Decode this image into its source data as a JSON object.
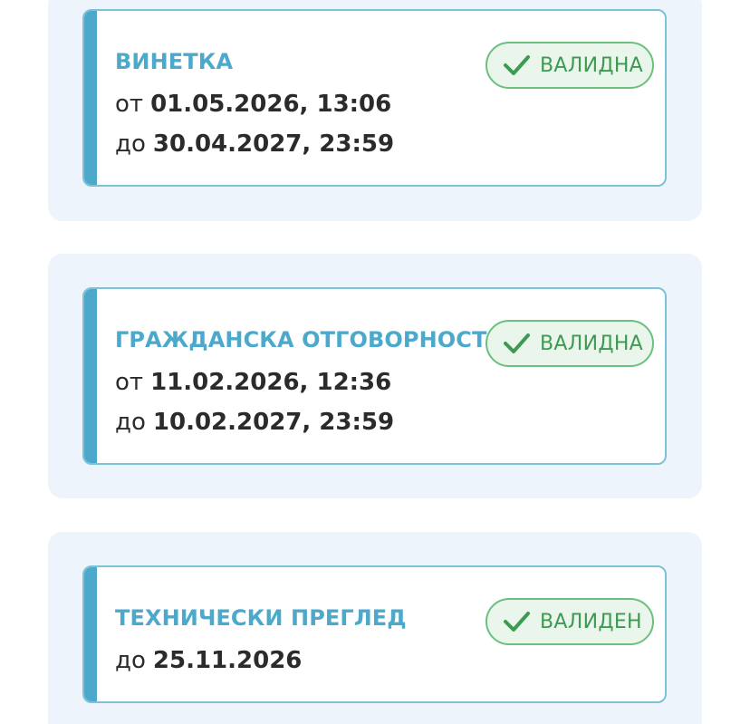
{
  "cards": [
    {
      "title": "ВИНЕТКА",
      "from_prefix": "от",
      "from_value": "01.05.2026, 13:06",
      "to_prefix": "до",
      "to_value": "30.04.2027, 23:59",
      "status": "ВАЛИДНА",
      "status_icon": "check-icon"
    },
    {
      "title": "ГРАЖДАНСКА ОТГОВОРНОСТ",
      "from_prefix": "от",
      "from_value": "11.02.2026, 12:36",
      "to_prefix": "до",
      "to_value": "10.02.2027, 23:59",
      "status": "ВАЛИДНА",
      "status_icon": "check-icon"
    },
    {
      "title": "ТЕХНИЧЕСКИ ПРЕГЛЕД",
      "to_prefix": "до",
      "to_value": "25.11.2026",
      "status": "ВАЛИДЕН",
      "status_icon": "check-icon"
    }
  ],
  "colors": {
    "accent": "#4ca9cb",
    "panel_bg": "#edf4fb",
    "valid_green": "#3e9a52",
    "valid_bg": "#eaf6ec"
  }
}
